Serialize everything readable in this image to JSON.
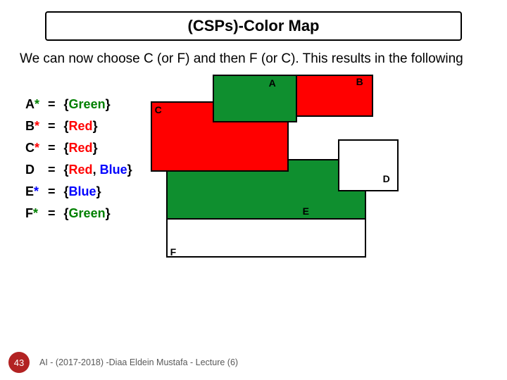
{
  "title": "(CSPs)-Color Map",
  "body": "We can now choose C (or F) and then F (or C). This results in the following",
  "assignments": [
    {
      "var": "A",
      "starColor": "green",
      "parts": [
        {
          "t": "Green",
          "c": "green"
        }
      ]
    },
    {
      "var": "B",
      "starColor": "red",
      "parts": [
        {
          "t": "Red",
          "c": "red"
        }
      ]
    },
    {
      "var": "C",
      "starColor": "red",
      "parts": [
        {
          "t": "Red",
          "c": "red"
        }
      ]
    },
    {
      "var": "D",
      "starColor": null,
      "parts": [
        {
          "t": "Red",
          "c": "red"
        },
        {
          "t": ", ",
          "c": "black"
        },
        {
          "t": "Blue",
          "c": "blue"
        }
      ]
    },
    {
      "var": "E",
      "starColor": "blue",
      "parts": [
        {
          "t": "Blue",
          "c": "blue"
        }
      ]
    },
    {
      "var": "F",
      "starColor": "green",
      "parts": [
        {
          "t": "Green",
          "c": "green"
        }
      ]
    }
  ],
  "map": {
    "labels": {
      "a": "A",
      "b": "B",
      "c": "C",
      "d": "D",
      "e": "E",
      "f": "F"
    }
  },
  "footer": {
    "slideNumber": "43",
    "text": "AI - (2017-2018) -Diaa Eldein Mustafa - Lecture (6)"
  }
}
